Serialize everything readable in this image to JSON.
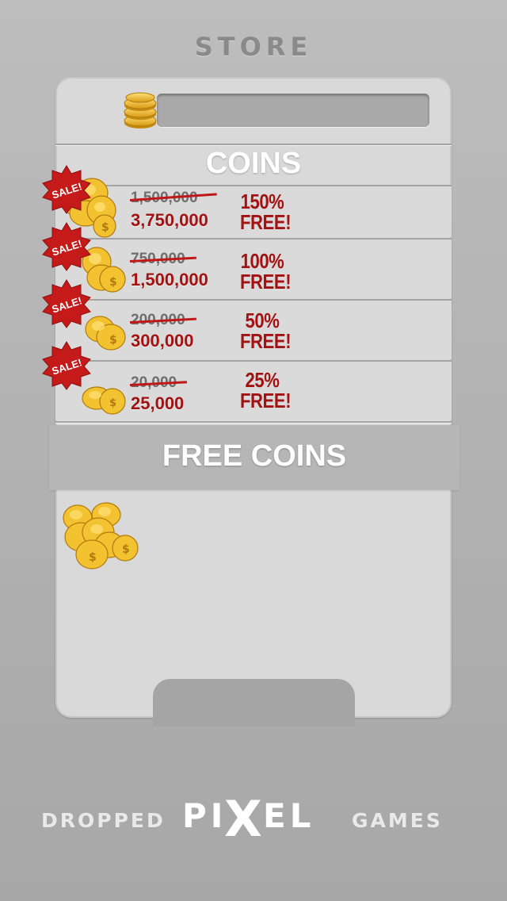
{
  "header": {
    "title": "STORE"
  },
  "balance": {
    "value": ""
  },
  "sections": {
    "coins_title": "COINS",
    "free_coins_title": "FREE COINS"
  },
  "offers": [
    {
      "old_amount": "1,500,000",
      "new_amount": "3,750,000",
      "bonus_percent": "150%",
      "bonus_word": "FREE!",
      "badge": "SALE!"
    },
    {
      "old_amount": "750,000",
      "new_amount": "1,500,000",
      "bonus_percent": "100%",
      "bonus_word": "FREE!",
      "badge": "SALE!"
    },
    {
      "old_amount": "200,000",
      "new_amount": "300,000",
      "bonus_percent": "50%",
      "bonus_word": "FREE!",
      "badge": "SALE!"
    },
    {
      "old_amount": "20,000",
      "new_amount": "25,000",
      "bonus_percent": "25%",
      "bonus_word": "FREE!",
      "badge": "SALE!"
    }
  ],
  "logo": {
    "left": "DROPPED",
    "pi": "PI",
    "x": "X",
    "el": "EL",
    "right": "GAMES"
  },
  "colors": {
    "background": "#b3b3b3",
    "panel": "#d9d9d9",
    "sale_red": "#c41a1a",
    "price_red": "#a31212",
    "coin_gold": "#f2c230"
  },
  "icons": {
    "coin": "coin-stack-icon",
    "sale": "sale-burst-icon"
  }
}
